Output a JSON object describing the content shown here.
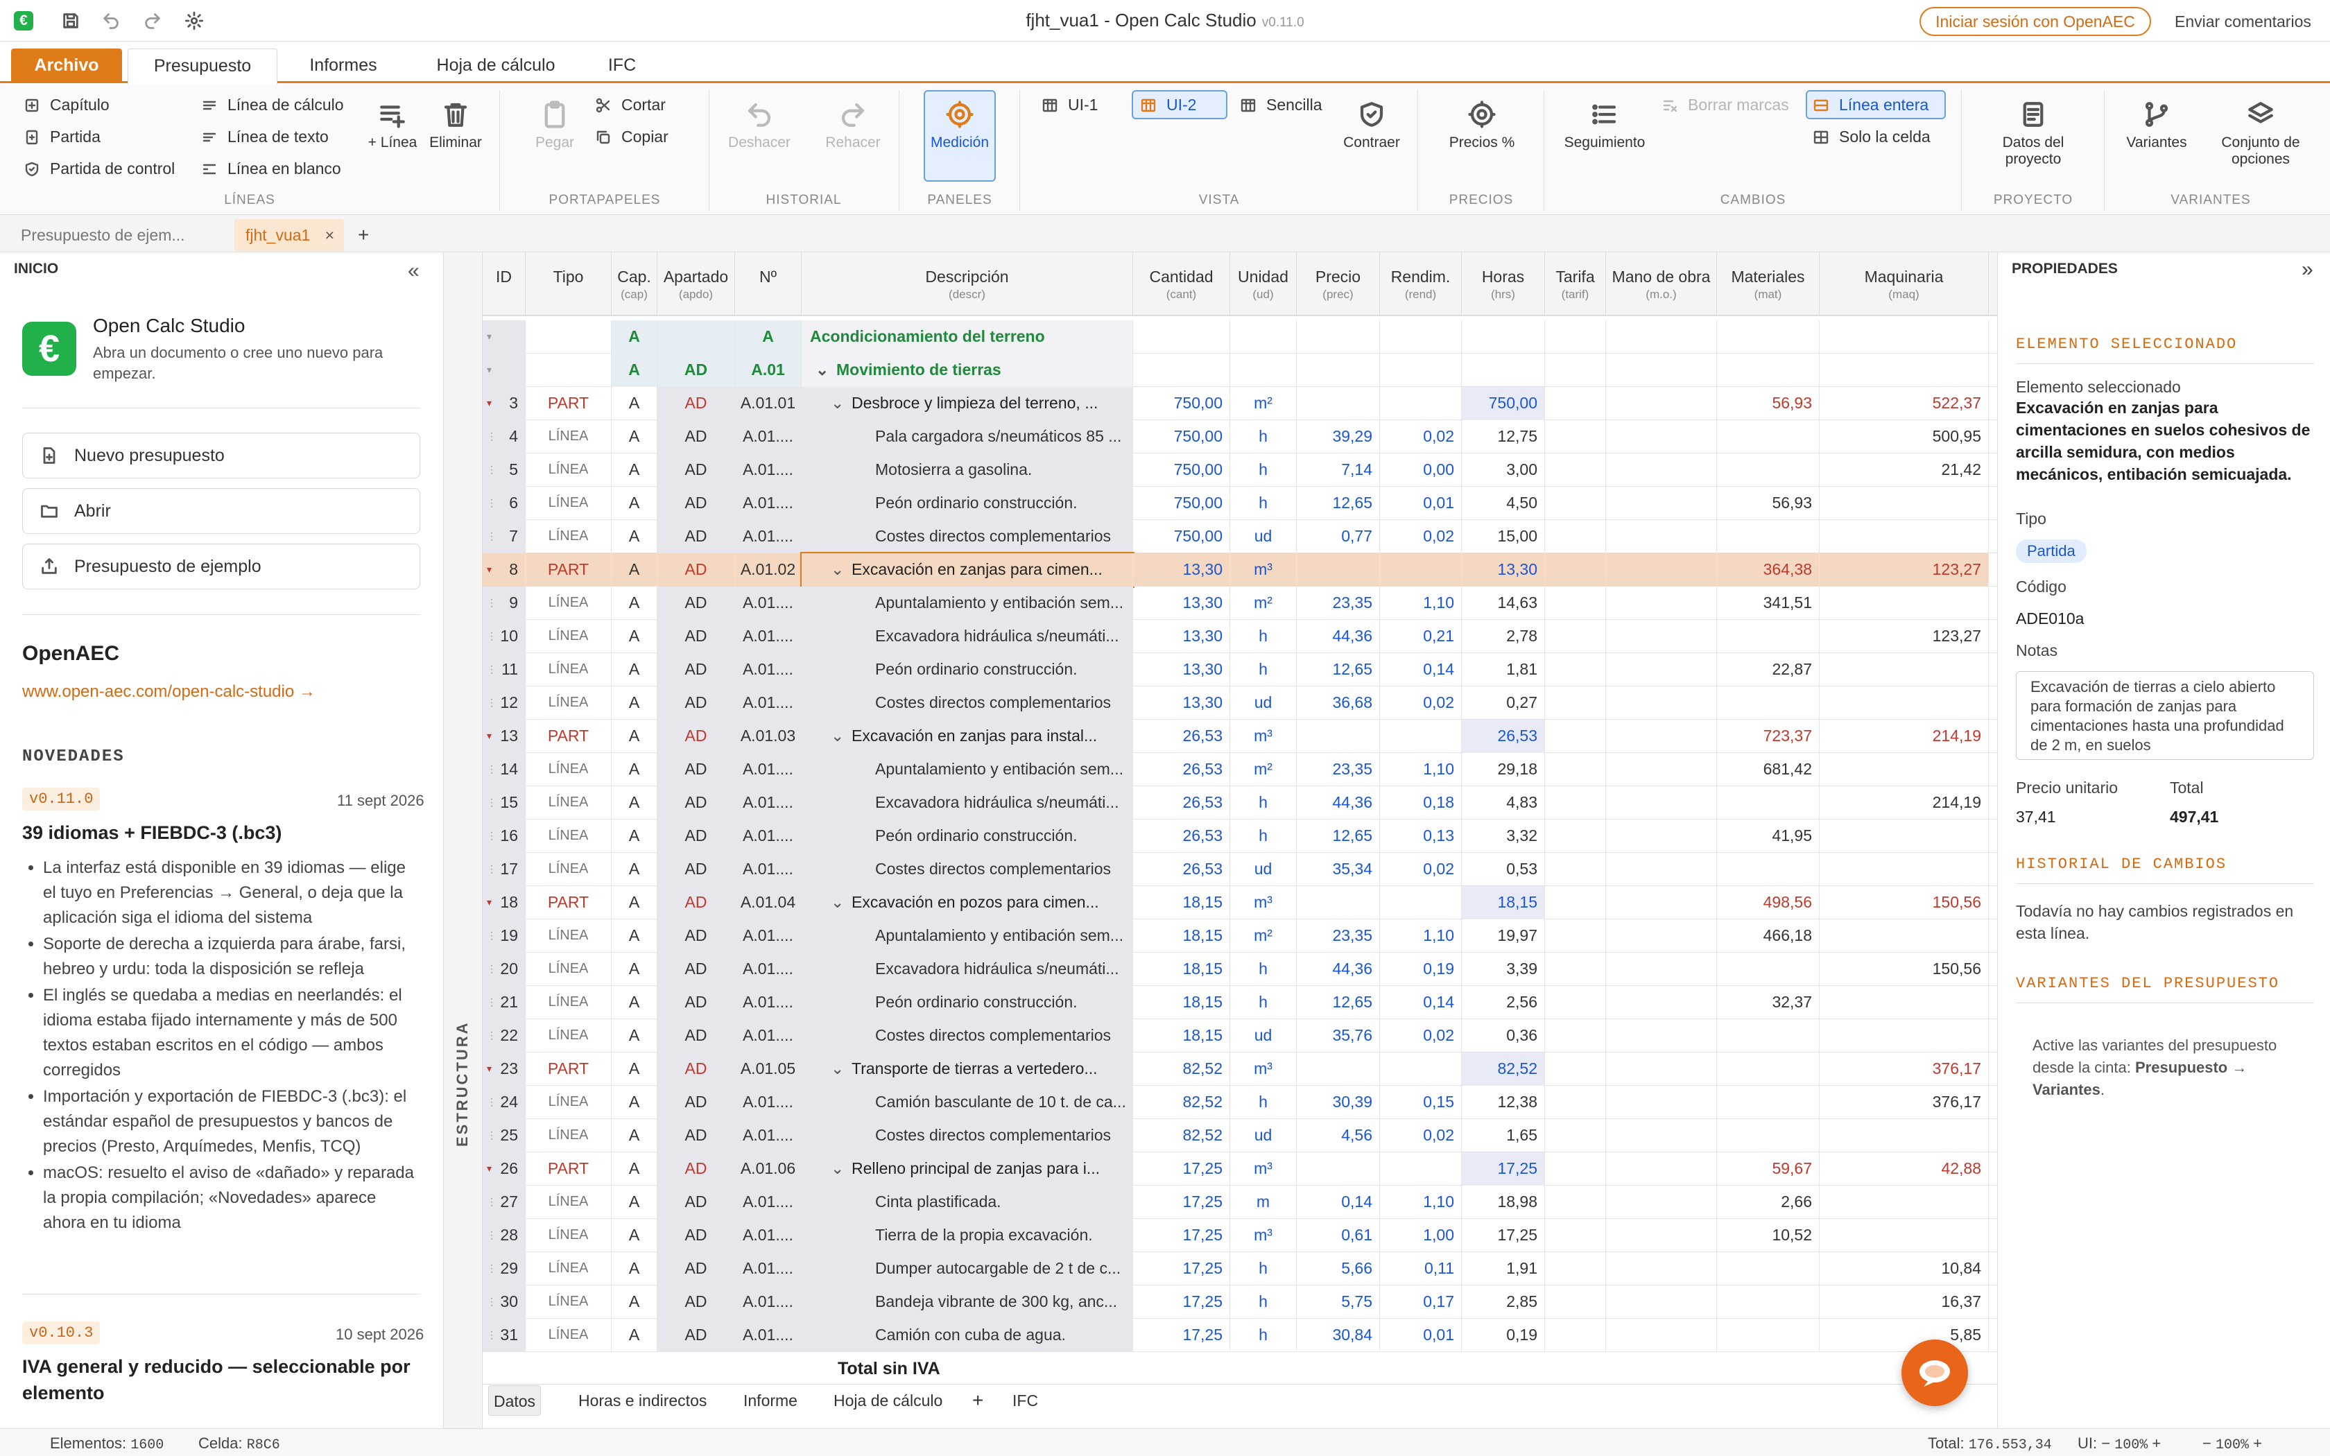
{
  "window": {
    "title": "fjht_vua1 - Open Calc Studio",
    "version": "v0.11.0",
    "login": "Iniciar sesión con OpenAEC",
    "feedback": "Enviar comentarios"
  },
  "menu": {
    "archivo": "Archivo",
    "tabs": [
      "Presupuesto",
      "Informes",
      "Hoja de cálculo",
      "IFC"
    ]
  },
  "ribbon": {
    "lineas": {
      "capitulo": "Capítulo",
      "partida": "Partida",
      "partida_control": "Partida de control",
      "linea_calculo": "Línea de cálculo",
      "linea_texto": "Línea de texto",
      "linea_blanco": "Línea en blanco",
      "add_linea": "+ Línea",
      "eliminar": "Eliminar",
      "group": "LÍNEAS"
    },
    "portapapeles": {
      "pegar": "Pegar",
      "cortar": "Cortar",
      "copiar": "Copiar",
      "group": "PORTAPAPELES"
    },
    "historial": {
      "deshacer": "Deshacer",
      "rehacer": "Rehacer",
      "group": "HISTORIAL"
    },
    "paneles": {
      "medicion": "Medición",
      "group": "PANELES"
    },
    "vista": {
      "ui1": "UI-1",
      "ui2": "UI-2",
      "sencilla": "Sencilla",
      "contraer": "Contraer",
      "group": "VISTA"
    },
    "precios": {
      "precios_pct": "Precios %",
      "group": "PRECIOS"
    },
    "cambios": {
      "seguimiento": "Seguimiento",
      "borrar_marcas": "Borrar marcas",
      "linea_entera": "Línea entera",
      "solo_celda": "Solo la celda",
      "group": "CAMBIOS"
    },
    "proyecto": {
      "datos1": "Datos del",
      "datos2": "proyecto",
      "group": "PROYECTO"
    },
    "variantes": {
      "variantes": "Variantes",
      "conjunto1": "Conjunto de",
      "conjunto2": "opciones",
      "group": "VARIANTES"
    }
  },
  "doctabs": {
    "tab1": "Presupuesto de ejem...",
    "tab2": "fjht_vua1",
    "add": "+"
  },
  "left": {
    "header": "INICIO",
    "app_name": "Open Calc Studio",
    "app_desc1": "Abra un documento o cree uno nuevo para",
    "app_desc2": "empezar.",
    "btn_new": "Nuevo presupuesto",
    "btn_open": "Abrir",
    "btn_sample": "Presupuesto de ejemplo",
    "openaec": "OpenAEC",
    "link": "www.open-aec.com/open-calc-studio →",
    "novedades": "NOVEDADES",
    "news1": {
      "ver": "v0.11.0",
      "date": "11 sept 2026",
      "title": "39 idiomas + FIEBDC-3 (.bc3)",
      "items": [
        "La interfaz está disponible en 39 idiomas — elige el tuyo en Preferencias → General, o deja que la aplicación siga el idioma del sistema",
        "Soporte de derecha a izquierda para árabe, farsi, hebreo y urdu: toda la disposición se refleja",
        "El inglés se quedaba a medias en neerlandés: el idioma estaba fijado internamente y más de 500 textos estaban escritos en el código — ambos corregidos",
        "Importación y exportación de FIEBDC-3 (.bc3): el estándar español de presupuestos y bancos de precios (Presto, Arquímedes, Menfis, TCQ)",
        "macOS: resuelto el aviso de «dañado» y reparada la propia compilación; «Novedades» aparece ahora en tu idioma"
      ]
    },
    "news2": {
      "ver": "v0.10.3",
      "date": "10 sept 2026",
      "title1": "IVA general y reducido — seleccionable por",
      "title2": "elemento"
    }
  },
  "structure_label": "ESTRUCTURA",
  "grid": {
    "headers": [
      {
        "t": "ID",
        "s": ""
      },
      {
        "t": "Tipo",
        "s": ""
      },
      {
        "t": "Cap.",
        "s": "(cap)"
      },
      {
        "t": "Apartado",
        "s": "(apdo)"
      },
      {
        "t": "Nº",
        "s": ""
      },
      {
        "t": "Descripción",
        "s": "(descr)"
      },
      {
        "t": "Cantidad",
        "s": "(cant)"
      },
      {
        "t": "Unidad",
        "s": "(ud)"
      },
      {
        "t": "Precio",
        "s": "(prec)"
      },
      {
        "t": "Rendim.",
        "s": "(rend)"
      },
      {
        "t": "Horas",
        "s": "(hrs)"
      },
      {
        "t": "Tarifa",
        "s": "(tarif)"
      },
      {
        "t": "Mano de obra",
        "s": "(m.o.)"
      },
      {
        "t": "Materiales",
        "s": "(mat)"
      },
      {
        "t": "Maquinaria",
        "s": "(maq)"
      }
    ],
    "rows": [
      {
        "id": "",
        "type": "",
        "cap": "A",
        "ap": "",
        "no": "A",
        "desc": "Acondicionamiento del terreno",
        "kind": "chap",
        "lvl": 0,
        "cant": "",
        "ud": "",
        "prec": "",
        "rend": "",
        "hrs": "",
        "mat": "",
        "maq": ""
      },
      {
        "id": "",
        "type": "",
        "cap": "A",
        "ap": "AD",
        "no": "A.01",
        "desc": "Movimiento de tierras",
        "kind": "chap",
        "lvl": 1,
        "cant": "",
        "ud": "",
        "prec": "",
        "rend": "",
        "hrs": "",
        "mat": "",
        "maq": ""
      },
      {
        "id": "3",
        "type": "PART",
        "cap": "A",
        "ap": "AD",
        "no": "A.01.01",
        "desc": "Desbroce y limpieza del terreno, ...",
        "kind": "part",
        "cant": "750,00",
        "ud": "m²",
        "prec": "",
        "rend": "",
        "hrs": "750,00",
        "mat": "56,93",
        "maq": "522,37"
      },
      {
        "id": "4",
        "type": "LÍNEA",
        "cap": "A",
        "ap": "AD",
        "no": "A.01....",
        "desc": "Pala cargadora s/neumáticos 85 ...",
        "kind": "line",
        "cant": "750,00",
        "ud": "h",
        "prec": "39,29",
        "rend": "0,02",
        "hrs": "12,75",
        "mat": "",
        "maq": "500,95"
      },
      {
        "id": "5",
        "type": "LÍNEA",
        "cap": "A",
        "ap": "AD",
        "no": "A.01....",
        "desc": "Motosierra a gasolina.",
        "kind": "line",
        "cant": "750,00",
        "ud": "h",
        "prec": "7,14",
        "rend": "0,00",
        "hrs": "3,00",
        "mat": "",
        "maq": "21,42"
      },
      {
        "id": "6",
        "type": "LÍNEA",
        "cap": "A",
        "ap": "AD",
        "no": "A.01....",
        "desc": "Peón ordinario construcción.",
        "kind": "line",
        "cant": "750,00",
        "ud": "h",
        "prec": "12,65",
        "rend": "0,01",
        "hrs": "4,50",
        "mat": "56,93",
        "maq": ""
      },
      {
        "id": "7",
        "type": "LÍNEA",
        "cap": "A",
        "ap": "AD",
        "no": "A.01....",
        "desc": "Costes directos complementarios",
        "kind": "line",
        "cant": "750,00",
        "ud": "ud",
        "prec": "0,77",
        "rend": "0,02",
        "hrs": "15,00",
        "mat": "",
        "maq": ""
      },
      {
        "id": "8",
        "type": "PART",
        "cap": "A",
        "ap": "AD",
        "no": "A.01.02",
        "desc": "Excavación en zanjas para cimen...",
        "kind": "part",
        "sel": true,
        "cant": "13,30",
        "ud": "m³",
        "prec": "",
        "rend": "",
        "hrs": "13,30",
        "mat": "364,38",
        "maq": "123,27"
      },
      {
        "id": "9",
        "type": "LÍNEA",
        "cap": "A",
        "ap": "AD",
        "no": "A.01....",
        "desc": "Apuntalamiento y entibación sem...",
        "kind": "line",
        "cant": "13,30",
        "ud": "m²",
        "prec": "23,35",
        "rend": "1,10",
        "hrs": "14,63",
        "mat": "341,51",
        "maq": ""
      },
      {
        "id": "10",
        "type": "LÍNEA",
        "cap": "A",
        "ap": "AD",
        "no": "A.01....",
        "desc": "Excavadora hidráulica s/neumáti...",
        "kind": "line",
        "cant": "13,30",
        "ud": "h",
        "prec": "44,36",
        "rend": "0,21",
        "hrs": "2,78",
        "mat": "",
        "maq": "123,27"
      },
      {
        "id": "11",
        "type": "LÍNEA",
        "cap": "A",
        "ap": "AD",
        "no": "A.01....",
        "desc": "Peón ordinario construcción.",
        "kind": "line",
        "cant": "13,30",
        "ud": "h",
        "prec": "12,65",
        "rend": "0,14",
        "hrs": "1,81",
        "mat": "22,87",
        "maq": ""
      },
      {
        "id": "12",
        "type": "LÍNEA",
        "cap": "A",
        "ap": "AD",
        "no": "A.01....",
        "desc": "Costes directos complementarios",
        "kind": "line",
        "cant": "13,30",
        "ud": "ud",
        "prec": "36,68",
        "rend": "0,02",
        "hrs": "0,27",
        "mat": "",
        "maq": ""
      },
      {
        "id": "13",
        "type": "PART",
        "cap": "A",
        "ap": "AD",
        "no": "A.01.03",
        "desc": "Excavación en zanjas para instal...",
        "kind": "part",
        "cant": "26,53",
        "ud": "m³",
        "prec": "",
        "rend": "",
        "hrs": "26,53",
        "mat": "723,37",
        "maq": "214,19"
      },
      {
        "id": "14",
        "type": "LÍNEA",
        "cap": "A",
        "ap": "AD",
        "no": "A.01....",
        "desc": "Apuntalamiento y entibación sem...",
        "kind": "line",
        "cant": "26,53",
        "ud": "m²",
        "prec": "23,35",
        "rend": "1,10",
        "hrs": "29,18",
        "mat": "681,42",
        "maq": ""
      },
      {
        "id": "15",
        "type": "LÍNEA",
        "cap": "A",
        "ap": "AD",
        "no": "A.01....",
        "desc": "Excavadora hidráulica s/neumáti...",
        "kind": "line",
        "cant": "26,53",
        "ud": "h",
        "prec": "44,36",
        "rend": "0,18",
        "hrs": "4,83",
        "mat": "",
        "maq": "214,19"
      },
      {
        "id": "16",
        "type": "LÍNEA",
        "cap": "A",
        "ap": "AD",
        "no": "A.01....",
        "desc": "Peón ordinario construcción.",
        "kind": "line",
        "cant": "26,53",
        "ud": "h",
        "prec": "12,65",
        "rend": "0,13",
        "hrs": "3,32",
        "mat": "41,95",
        "maq": ""
      },
      {
        "id": "17",
        "type": "LÍNEA",
        "cap": "A",
        "ap": "AD",
        "no": "A.01....",
        "desc": "Costes directos complementarios",
        "kind": "line",
        "cant": "26,53",
        "ud": "ud",
        "prec": "35,34",
        "rend": "0,02",
        "hrs": "0,53",
        "mat": "",
        "maq": ""
      },
      {
        "id": "18",
        "type": "PART",
        "cap": "A",
        "ap": "AD",
        "no": "A.01.04",
        "desc": "Excavación en pozos para cimen...",
        "kind": "part",
        "cant": "18,15",
        "ud": "m³",
        "prec": "",
        "rend": "",
        "hrs": "18,15",
        "mat": "498,56",
        "maq": "150,56"
      },
      {
        "id": "19",
        "type": "LÍNEA",
        "cap": "A",
        "ap": "AD",
        "no": "A.01....",
        "desc": "Apuntalamiento y entibación sem...",
        "kind": "line",
        "cant": "18,15",
        "ud": "m²",
        "prec": "23,35",
        "rend": "1,10",
        "hrs": "19,97",
        "mat": "466,18",
        "maq": ""
      },
      {
        "id": "20",
        "type": "LÍNEA",
        "cap": "A",
        "ap": "AD",
        "no": "A.01....",
        "desc": "Excavadora hidráulica s/neumáti...",
        "kind": "line",
        "cant": "18,15",
        "ud": "h",
        "prec": "44,36",
        "rend": "0,19",
        "hrs": "3,39",
        "mat": "",
        "maq": "150,56"
      },
      {
        "id": "21",
        "type": "LÍNEA",
        "cap": "A",
        "ap": "AD",
        "no": "A.01....",
        "desc": "Peón ordinario construcción.",
        "kind": "line",
        "cant": "18,15",
        "ud": "h",
        "prec": "12,65",
        "rend": "0,14",
        "hrs": "2,56",
        "mat": "32,37",
        "maq": ""
      },
      {
        "id": "22",
        "type": "LÍNEA",
        "cap": "A",
        "ap": "AD",
        "no": "A.01....",
        "desc": "Costes directos complementarios",
        "kind": "line",
        "cant": "18,15",
        "ud": "ud",
        "prec": "35,76",
        "rend": "0,02",
        "hrs": "0,36",
        "mat": "",
        "maq": ""
      },
      {
        "id": "23",
        "type": "PART",
        "cap": "A",
        "ap": "AD",
        "no": "A.01.05",
        "desc": "Transporte de tierras a vertedero...",
        "kind": "part",
        "cant": "82,52",
        "ud": "m³",
        "prec": "",
        "rend": "",
        "hrs": "82,52",
        "mat": "",
        "maq": "376,17"
      },
      {
        "id": "24",
        "type": "LÍNEA",
        "cap": "A",
        "ap": "AD",
        "no": "A.01....",
        "desc": "Camión basculante de 10 t. de ca...",
        "kind": "line",
        "cant": "82,52",
        "ud": "h",
        "prec": "30,39",
        "rend": "0,15",
        "hrs": "12,38",
        "mat": "",
        "maq": "376,17"
      },
      {
        "id": "25",
        "type": "LÍNEA",
        "cap": "A",
        "ap": "AD",
        "no": "A.01....",
        "desc": "Costes directos complementarios",
        "kind": "line",
        "cant": "82,52",
        "ud": "ud",
        "prec": "4,56",
        "rend": "0,02",
        "hrs": "1,65",
        "mat": "",
        "maq": ""
      },
      {
        "id": "26",
        "type": "PART",
        "cap": "A",
        "ap": "AD",
        "no": "A.01.06",
        "desc": "Relleno principal de zanjas para i...",
        "kind": "part",
        "cant": "17,25",
        "ud": "m³",
        "prec": "",
        "rend": "",
        "hrs": "17,25",
        "mat": "59,67",
        "maq": "42,88"
      },
      {
        "id": "27",
        "type": "LÍNEA",
        "cap": "A",
        "ap": "AD",
        "no": "A.01....",
        "desc": "Cinta plastificada.",
        "kind": "line",
        "cant": "17,25",
        "ud": "m",
        "prec": "0,14",
        "rend": "1,10",
        "hrs": "18,98",
        "mat": "2,66",
        "maq": ""
      },
      {
        "id": "28",
        "type": "LÍNEA",
        "cap": "A",
        "ap": "AD",
        "no": "A.01....",
        "desc": "Tierra de la propia excavación.",
        "kind": "line",
        "cant": "17,25",
        "ud": "m³",
        "prec": "0,61",
        "rend": "1,00",
        "hrs": "17,25",
        "mat": "10,52",
        "maq": ""
      },
      {
        "id": "29",
        "type": "LÍNEA",
        "cap": "A",
        "ap": "AD",
        "no": "A.01....",
        "desc": "Dumper autocargable de 2 t de c...",
        "kind": "line",
        "cant": "17,25",
        "ud": "h",
        "prec": "5,66",
        "rend": "0,11",
        "hrs": "1,91",
        "mat": "",
        "maq": "10,84"
      },
      {
        "id": "30",
        "type": "LÍNEA",
        "cap": "A",
        "ap": "AD",
        "no": "A.01....",
        "desc": "Bandeja vibrante de 300 kg, anc...",
        "kind": "line",
        "cant": "17,25",
        "ud": "h",
        "prec": "5,75",
        "rend": "0,17",
        "hrs": "2,85",
        "mat": "",
        "maq": "16,37"
      },
      {
        "id": "31",
        "type": "LÍNEA",
        "cap": "A",
        "ap": "AD",
        "no": "A.01....",
        "desc": "Camión con cuba de agua.",
        "kind": "line",
        "cant": "17,25",
        "ud": "h",
        "prec": "30,84",
        "rend": "0,01",
        "hrs": "0,19",
        "mat": "",
        "maq": "5,85"
      }
    ],
    "total_label": "Total sin IVA"
  },
  "right": {
    "header": "PROPIEDADES",
    "sel_head": "ELEMENTO SELECCIONADO",
    "sel_label": "Elemento seleccionado",
    "sel_name": "Excavación en zanjas para cimentaciones en suelos cohesivos de arcilla semidura, con medios mecánicos, entibación semicuajada.",
    "tipo_label": "Tipo",
    "tipo": "Partida",
    "codigo_label": "Código",
    "codigo": "ADE010a",
    "notas_label": "Notas",
    "notas": "Excavación de tierras a cielo abierto para formación de zanjas para cimentaciones hasta una profundidad de 2 m, en suelos",
    "pu_label": "Precio unitario",
    "pu": "37,41",
    "total_label": "Total",
    "total": "497,41",
    "hist_head": "HISTORIAL DE CAMBIOS",
    "hist_text": "Todavía no hay cambios registrados en esta línea.",
    "var_head": "VARIANTES DEL PRESUPUESTO",
    "var_text1": "Active las variantes del presupuesto desde la cinta: ",
    "var_text2": "Presupuesto → Variantes",
    "var_text3": "."
  },
  "bottom_tabs": [
    "Datos",
    "Horas e indirectos",
    "Informe",
    "Hoja de cálculo",
    "+",
    "IFC"
  ],
  "status": {
    "elementos_label": "Elementos:",
    "elementos": "1600",
    "celda_label": "Celda:",
    "celda": "R8C6",
    "total_label": "Total:",
    "total": "176.553,34",
    "ui_label": "UI:",
    "zoom1": "100%",
    "zoom2": "100%"
  },
  "colors": {
    "accent": "#e07b1a",
    "selected_row": "#f4d8c1",
    "blue_value": "#1a56d6",
    "red_value": "#c0392b",
    "chapter_green": "#1e8a3a"
  }
}
